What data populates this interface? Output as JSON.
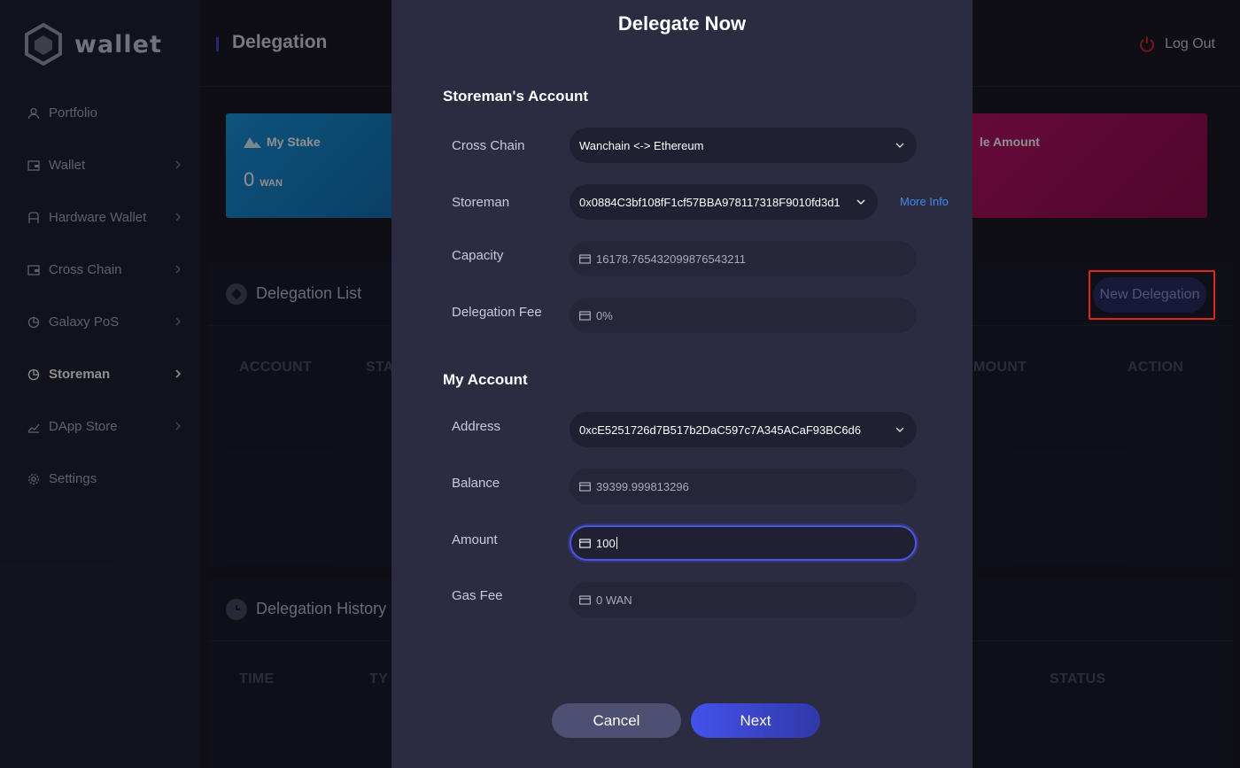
{
  "app": {
    "logo_text": "wallet"
  },
  "sidebar": {
    "items": [
      {
        "label": "Portfolio",
        "icon": "user-icon",
        "has_arrow": false,
        "active": false
      },
      {
        "label": "Wallet",
        "icon": "wallet-icon",
        "has_arrow": true,
        "active": false
      },
      {
        "label": "Hardware Wallet",
        "icon": "hardware-wallet-icon",
        "has_arrow": true,
        "active": false
      },
      {
        "label": "Cross Chain",
        "icon": "cross-chain-icon",
        "has_arrow": true,
        "active": false
      },
      {
        "label": "Galaxy PoS",
        "icon": "pie-chart-icon",
        "has_arrow": true,
        "active": false
      },
      {
        "label": "Storeman",
        "icon": "pie-chart-icon",
        "has_arrow": true,
        "active": true
      },
      {
        "label": "DApp Store",
        "icon": "chart-line-icon",
        "has_arrow": true,
        "active": false
      },
      {
        "label": "Settings",
        "icon": "gear-icon",
        "has_arrow": false,
        "active": false
      }
    ]
  },
  "header": {
    "title": "Delegation",
    "logout_label": "Log Out"
  },
  "cards": {
    "my_stake": {
      "title": "My Stake",
      "value": "0",
      "unit": "WAN"
    },
    "withdrawable": {
      "title_partial": "le Amount"
    }
  },
  "delegation_list": {
    "title": "Delegation List",
    "new_button_label": "New Delegation",
    "columns_visible": [
      "ACCOUNT",
      "STA",
      "MOUNT",
      "ACTION"
    ]
  },
  "delegation_history": {
    "title": "Delegation History",
    "columns_visible": [
      "TIME",
      "TY",
      "STATUS"
    ]
  },
  "modal": {
    "title": "Delegate Now",
    "storeman_section": {
      "title": "Storeman's Account",
      "cross_chain": {
        "label": "Cross Chain",
        "value": "Wanchain <-> Ethereum"
      },
      "storeman": {
        "label": "Storeman",
        "value": "0x0884C3bf108fF1cf57BBA978117318F9010fd3d1",
        "more_info": "More Info"
      },
      "capacity": {
        "label": "Capacity",
        "value": "16178.765432099876543211"
      },
      "delegation_fee": {
        "label": "Delegation Fee",
        "value": "0%"
      }
    },
    "my_account_section": {
      "title": "My Account",
      "address": {
        "label": "Address",
        "value": "0xcE5251726d7B517b2DaC597c7A345ACaF93BC6d6"
      },
      "balance": {
        "label": "Balance",
        "value": "39399.999813296"
      },
      "amount": {
        "label": "Amount",
        "value": "100"
      },
      "gas_fee": {
        "label": "Gas Fee",
        "value": "0 WAN"
      }
    },
    "buttons": {
      "cancel": "Cancel",
      "next": "Next"
    }
  },
  "colors": {
    "accent": "#4452ea",
    "highlight": "#e2231f",
    "card_blue": "#1591d6",
    "card_pink": "#b40d5f",
    "modal_bg": "#2b2c42",
    "link": "#3b8cf0"
  }
}
